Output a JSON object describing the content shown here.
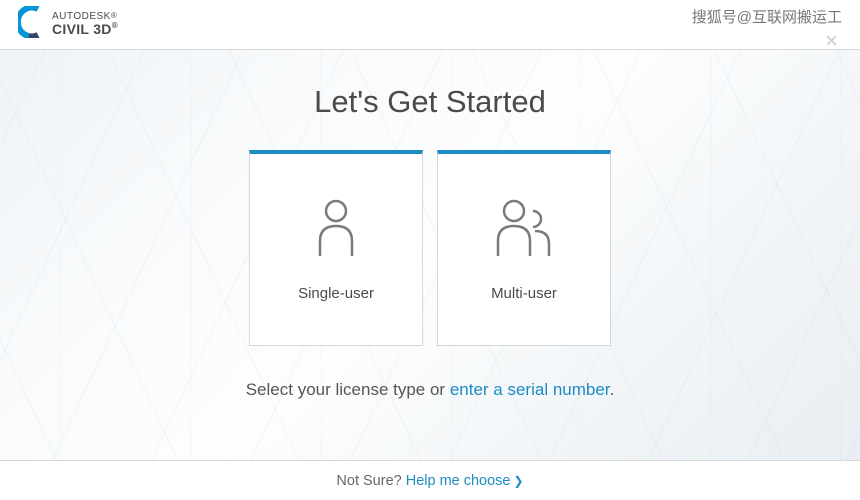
{
  "header": {
    "brand_line1": "AUTODESK",
    "brand_line2": "CIVIL 3D",
    "reg_mark": "®"
  },
  "watermark": "搜狐号@互联网搬运工",
  "main": {
    "title": "Let's Get Started",
    "cards": [
      {
        "label": "Single-user",
        "icon": "person-icon"
      },
      {
        "label": "Multi-user",
        "icon": "people-icon"
      }
    ],
    "subtitle_prefix": "Select your license type or ",
    "subtitle_link": "enter a serial number",
    "subtitle_suffix": "."
  },
  "footer": {
    "prefix": "Not Sure? ",
    "link": "Help me choose"
  }
}
